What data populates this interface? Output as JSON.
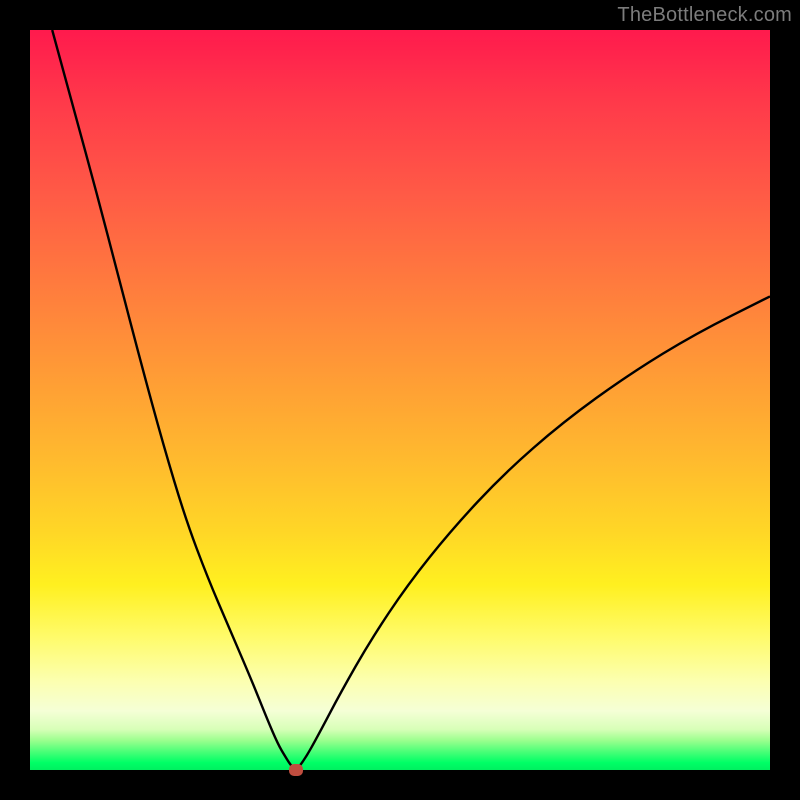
{
  "watermark": "TheBottleneck.com",
  "colors": {
    "frame": "#000000",
    "curve": "#000000",
    "marker": "#c04d3f",
    "gradient_stops": [
      {
        "offset": 0.0,
        "color": "#ff1a4d"
      },
      {
        "offset": 0.1,
        "color": "#ff3a4a"
      },
      {
        "offset": 0.22,
        "color": "#ff5a46"
      },
      {
        "offset": 0.34,
        "color": "#ff7a3e"
      },
      {
        "offset": 0.46,
        "color": "#ff9a36"
      },
      {
        "offset": 0.58,
        "color": "#ffba2e"
      },
      {
        "offset": 0.68,
        "color": "#ffd726"
      },
      {
        "offset": 0.75,
        "color": "#fff020"
      },
      {
        "offset": 0.82,
        "color": "#fffb6a"
      },
      {
        "offset": 0.88,
        "color": "#fcffb0"
      },
      {
        "offset": 0.92,
        "color": "#f5ffd6"
      },
      {
        "offset": 0.945,
        "color": "#d8ffb8"
      },
      {
        "offset": 0.96,
        "color": "#9bff8e"
      },
      {
        "offset": 0.975,
        "color": "#4bff78"
      },
      {
        "offset": 0.99,
        "color": "#00ff66"
      },
      {
        "offset": 1.0,
        "color": "#00f060"
      }
    ]
  },
  "chart_data": {
    "type": "line",
    "title": "",
    "xlabel": "",
    "ylabel": "",
    "xlim": [
      0,
      100
    ],
    "ylim": [
      0,
      100
    ],
    "minimum_marker": {
      "x": 36,
      "y": 0
    },
    "series": [
      {
        "name": "left-branch",
        "x": [
          3,
          6,
          9,
          12,
          15,
          18,
          21,
          24,
          27,
          30,
          32,
          33.5,
          34.5,
          35.2,
          35.7,
          36
        ],
        "y": [
          100,
          89,
          78,
          66.5,
          55,
          44,
          34,
          26,
          19,
          12,
          7,
          3.5,
          1.8,
          0.7,
          0.2,
          0
        ]
      },
      {
        "name": "right-branch",
        "x": [
          36,
          37,
          39,
          42,
          46,
          51,
          57,
          64,
          72,
          81,
          90,
          100
        ],
        "y": [
          0,
          1.2,
          4.8,
          10.5,
          17.5,
          25,
          32.5,
          40,
          47,
          53.5,
          59,
          64
        ]
      }
    ]
  }
}
